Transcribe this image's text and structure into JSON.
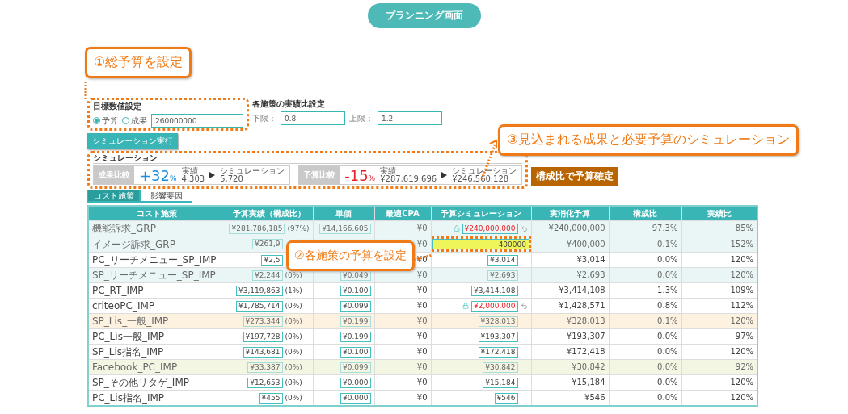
{
  "title_pill": "プランニング画面",
  "callouts": [
    {
      "text": "①総予算を設定"
    },
    {
      "text": "②各施策の予算を設定"
    },
    {
      "text": "③見込まれる成果と必要予算のシミュレーション"
    }
  ],
  "goal": {
    "label": "目標数値設定",
    "options": [
      {
        "label": "予算",
        "selected": true
      },
      {
        "label": "成果",
        "selected": false
      }
    ],
    "value": "260000000"
  },
  "ratio": {
    "label": "各施策の実績比設定",
    "lower_label": "下限：",
    "lower": "0.8",
    "upper_label": "上限：",
    "upper": "1.2"
  },
  "run_button": "シミュレーション実行",
  "simulation": {
    "heading": "シミュレーション",
    "comparisons": [
      {
        "label": "成果比較",
        "change": "+32",
        "unit": "%",
        "kind": "increase",
        "actual_label": "実績",
        "actual": "4,303",
        "sim_label": "シミュレーション",
        "sim": "5,720"
      },
      {
        "label": "予算比較",
        "change": "-15",
        "unit": "%",
        "kind": "decrease",
        "actual_label": "実績",
        "actual": "¥287,619,696",
        "sim_label": "シミュレーション",
        "sim": "¥246,560,128"
      }
    ],
    "confirm_button": "構成比で予算確定"
  },
  "tabs": [
    {
      "label": "コスト施策",
      "selected": true
    },
    {
      "label": "影響要因",
      "selected": false
    }
  ],
  "table": {
    "columns": [
      "コスト施策",
      "予算実績（構成比）",
      "単価",
      "最適CPA",
      "予算シミュレーション",
      "実消化予算",
      "構成比",
      "実績比"
    ],
    "rows": [
      {
        "name": "機能訴求_GRP",
        "color": "#eaf6f6",
        "muted": true,
        "budget": "¥281,786,185",
        "share": "(97%)",
        "price": "¥14,166.605",
        "cpa": "¥0",
        "sim": {
          "kind": "locked",
          "value": "¥240,000,000"
        },
        "spent": "¥240,000,000",
        "ratio": "97.3%",
        "performance": "85%"
      },
      {
        "name": "イメージ訴求_GRP",
        "color": "#eaf6f6",
        "muted": true,
        "budget": "¥261,9",
        "cpa": "¥0",
        "sim": {
          "kind": "input",
          "value": "400000"
        },
        "spent": "¥400,000",
        "ratio": "0.1%",
        "performance": "152%"
      },
      {
        "name": "PC_リーチメニュー_SP_IMP",
        "color": "#ffffff",
        "muted": false,
        "budget": "¥2,5",
        "cpa": "¥0",
        "sim": {
          "kind": "boxed",
          "value": "¥3,014"
        },
        "spent": "¥3,014",
        "ratio": "0.0%",
        "performance": "120%"
      },
      {
        "name": "SP_リーチメニュー_SP_IMP",
        "color": "#eaf6f6",
        "muted": true,
        "budget": "¥2,244",
        "share": "(0%)",
        "price": "¥0.049",
        "cpa": "¥0",
        "sim": {
          "kind": "boxed",
          "value": "¥2,693"
        },
        "spent": "¥2,693",
        "ratio": "0.0%",
        "performance": "120%"
      },
      {
        "name": "PC_RT_IMP",
        "color": "#ffffff",
        "muted": false,
        "budget": "¥3,119,863",
        "share": "(1%)",
        "price": "¥0.100",
        "cpa": "¥0",
        "sim": {
          "kind": "boxed",
          "value": "¥3,414,108"
        },
        "spent": "¥3,414,108",
        "ratio": "1.3%",
        "performance": "109%"
      },
      {
        "name": "criteoPC_IMP",
        "color": "#ffffff",
        "muted": false,
        "budget": "¥1,785,714",
        "share": "(0%)",
        "price": "¥0.099",
        "cpa": "¥0",
        "sim": {
          "kind": "locked",
          "value": "¥2,000,000"
        },
        "spent": "¥1,428,571",
        "ratio": "0.8%",
        "performance": "112%"
      },
      {
        "name": "SP_Lis_一般_IMP",
        "color": "#fdf1e0",
        "muted": true,
        "budget": "¥273,344",
        "share": "(0%)",
        "price": "¥0.199",
        "cpa": "¥0",
        "sim": {
          "kind": "boxed",
          "value": "¥328,013"
        },
        "spent": "¥328,013",
        "ratio": "0.1%",
        "performance": "120%"
      },
      {
        "name": "PC_Lis一般_IMP",
        "color": "#ffffff",
        "muted": false,
        "budget": "¥197,728",
        "share": "(0%)",
        "price": "¥0.199",
        "cpa": "¥0",
        "sim": {
          "kind": "boxed",
          "value": "¥193,307"
        },
        "spent": "¥193,307",
        "ratio": "0.0%",
        "performance": "97%"
      },
      {
        "name": "SP_Lis指名_IMP",
        "color": "#ffffff",
        "muted": false,
        "budget": "¥143,681",
        "share": "(0%)",
        "price": "¥0.100",
        "cpa": "¥0",
        "sim": {
          "kind": "boxed",
          "value": "¥172,418"
        },
        "spent": "¥172,418",
        "ratio": "0.0%",
        "performance": "120%"
      },
      {
        "name": "Facebook_PC_IMP",
        "color": "#f4f6e4",
        "muted": true,
        "budget": "¥33,387",
        "share": "(0%)",
        "price": "¥0.099",
        "cpa": "¥0",
        "sim": {
          "kind": "boxed",
          "value": "¥30,842"
        },
        "spent": "¥30,842",
        "ratio": "0.0%",
        "performance": "92%"
      },
      {
        "name": "SP_その他リタゲ_IMP",
        "color": "#ffffff",
        "muted": false,
        "budget": "¥12,653",
        "share": "(0%)",
        "price": "¥0.000",
        "cpa": "¥0",
        "sim": {
          "kind": "boxed",
          "value": "¥15,184"
        },
        "spent": "¥15,184",
        "ratio": "0.0%",
        "performance": "120%"
      },
      {
        "name": "PC_Lis指名_IMP",
        "color": "#ffffff",
        "muted": false,
        "budget": "¥455",
        "share": "(0%)",
        "price": "¥0.000",
        "cpa": "¥0",
        "sim": {
          "kind": "boxed",
          "value": "¥546"
        },
        "spent": "¥546",
        "ratio": "0.0%",
        "performance": "120%"
      }
    ]
  }
}
